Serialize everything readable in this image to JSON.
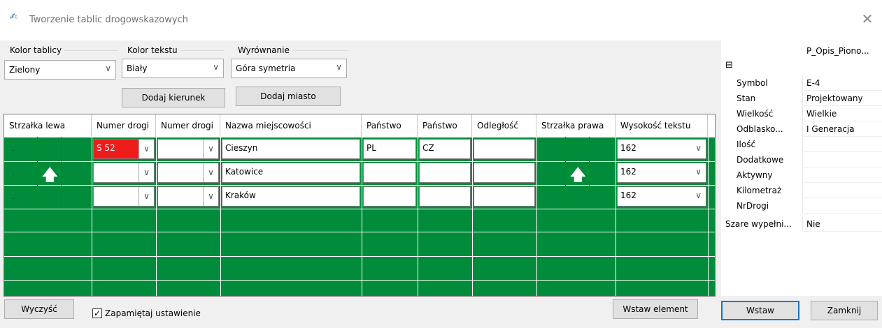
{
  "window": {
    "title": "Tworzenie tablic drogowskazowych",
    "close": "✕",
    "icon": "✍"
  },
  "groups": {
    "kolor_tablicy": {
      "label": "Kolor tablicy",
      "value": "Zielony"
    },
    "kolor_tekstu": {
      "label": "Kolor tekstu",
      "value": "Biały"
    },
    "wyrownanie": {
      "label": "Wyrównanie",
      "value": "Góra symetria"
    }
  },
  "buttons": {
    "dodaj_kierunek": "Dodaj kierunek",
    "dodaj_miasto": "Dodaj miasto",
    "wyczysc": "Wyczyść",
    "wstaw_element": "Wstaw element",
    "wstaw": "Wstaw",
    "zamknij": "Zamknij"
  },
  "checkbox": {
    "label": "Zapamiętaj ustawienie",
    "checked": true,
    "mark": "✓"
  },
  "grid": {
    "columns": [
      "Strzałka lewa",
      "Numer drogi",
      "Numer drogi",
      "Nazwa miejscowości",
      "Państwo",
      "Państwo",
      "Odległość",
      "Strzałka prawa",
      "Wysokość tekstu"
    ],
    "rows": [
      {
        "road1": "S 52",
        "road2": "",
        "city": "Cieszyn",
        "country1": "PL",
        "country2": "CZ",
        "distance": "",
        "height": "162",
        "left_arrow": false,
        "right_arrow": false
      },
      {
        "road1": "",
        "road2": "",
        "city": "Katowice",
        "country1": "",
        "country2": "",
        "distance": "",
        "height": "162",
        "left_arrow": true,
        "right_arrow": true
      },
      {
        "road1": "",
        "road2": "",
        "city": "Kraków",
        "country1": "",
        "country2": "",
        "distance": "",
        "height": "162",
        "left_arrow": false,
        "right_arrow": false
      }
    ],
    "arrow_glyph": "🡅",
    "dot": ".",
    "dd_glyph": "∨",
    "colors": {
      "grid_bg": "#008c3a",
      "highlight": "#ef1c1c"
    }
  },
  "properties": {
    "header": "P_Opis_Piono...",
    "collapse": "⊟",
    "items": [
      {
        "name": "Symbol",
        "value": "E-4"
      },
      {
        "name": "Stan",
        "value": "Projektowany"
      },
      {
        "name": "Wielkość",
        "value": "Wielkie"
      },
      {
        "name": "Odblasko...",
        "value": "I Generacja"
      },
      {
        "name": "Ilość",
        "value": ""
      },
      {
        "name": "Dodatkowe",
        "value": ""
      },
      {
        "name": "Aktywny",
        "value": ""
      },
      {
        "name": "Kilometraż",
        "value": ""
      },
      {
        "name": "NrDrogi",
        "value": ""
      }
    ],
    "extra": {
      "name": "Szare wypełni...",
      "value": "Nie"
    }
  }
}
